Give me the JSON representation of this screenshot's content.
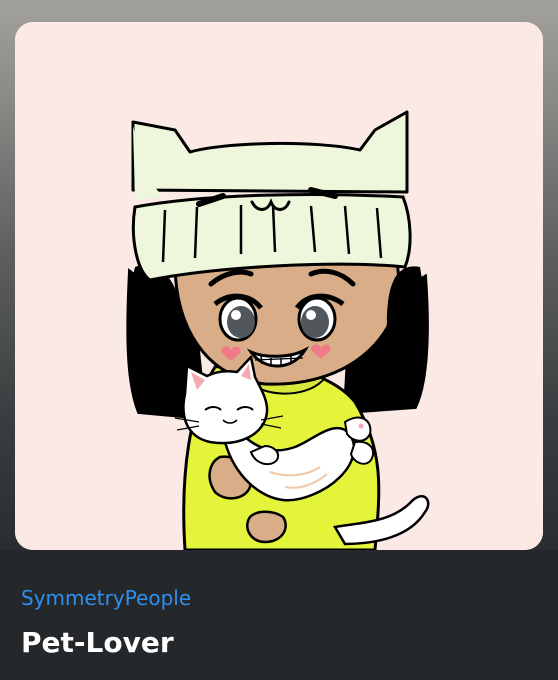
{
  "nft": {
    "collection": "SymmetryPeople",
    "title": "Pet-Lover"
  },
  "colors": {
    "accent": "#2f8ff0",
    "title": "#ffffff",
    "art_background": "#fbe9e6",
    "beanie": "#eef7dc",
    "sweater": "#e4f43a",
    "hair": "#000000",
    "skin": "#d8ad87",
    "cat": "#ffffff",
    "blush": "#f07a87"
  },
  "artwork": {
    "description_icon": "cartoon-girl-with-cat-icon"
  }
}
